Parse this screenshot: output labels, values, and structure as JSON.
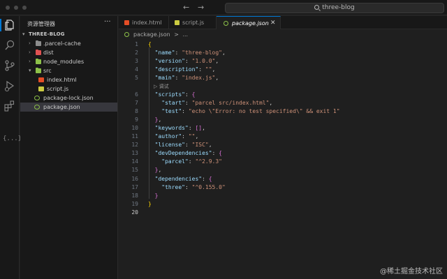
{
  "titlebar": {
    "search_text": "three-blog",
    "back_arrow": "←",
    "forward_arrow": "→"
  },
  "activity": {
    "extra_label": "{...}"
  },
  "sidebar": {
    "title": "资源管理器",
    "more": "···",
    "root": "THREE-BLOG",
    "items": [
      {
        "label": ".parcel-cache",
        "kind": "folder",
        "color": "#8c8c8c",
        "expanded": false
      },
      {
        "label": "dist",
        "kind": "folder",
        "color": "#e05252",
        "expanded": false
      },
      {
        "label": "node_modules",
        "kind": "folder",
        "color": "#8dc149",
        "expanded": false
      },
      {
        "label": "src",
        "kind": "folder",
        "color": "#8dc149",
        "expanded": true
      },
      {
        "label": "index.html",
        "kind": "file",
        "color": "#e44d26"
      },
      {
        "label": "script.js",
        "kind": "file",
        "color": "#cbcb41"
      },
      {
        "label": "package-lock.json",
        "kind": "file",
        "color": "#8dc149"
      },
      {
        "label": "package.json",
        "kind": "file",
        "color": "#8dc149",
        "selected": true
      }
    ]
  },
  "tabs": [
    {
      "label": "index.html",
      "color": "#e44d26"
    },
    {
      "label": "script.js",
      "color": "#cbcb41"
    },
    {
      "label": "package.json",
      "color": "#8dc149",
      "active": true,
      "close": "✕"
    }
  ],
  "breadcrumb": {
    "file": "package.json",
    "separator": ">",
    "rest": "..."
  },
  "codelens": "▷ 调试",
  "code_lines": [
    {
      "n": "1",
      "tokens": [
        [
          "br1",
          "{"
        ]
      ]
    },
    {
      "n": "2",
      "tokens": [
        [
          "p",
          "  "
        ],
        [
          "k",
          "\"name\""
        ],
        [
          "p",
          ": "
        ],
        [
          "s",
          "\"three-blog\""
        ],
        [
          "p",
          ","
        ]
      ]
    },
    {
      "n": "3",
      "tokens": [
        [
          "p",
          "  "
        ],
        [
          "k",
          "\"version\""
        ],
        [
          "p",
          ": "
        ],
        [
          "s",
          "\"1.0.0\""
        ],
        [
          "p",
          ","
        ]
      ]
    },
    {
      "n": "4",
      "tokens": [
        [
          "p",
          "  "
        ],
        [
          "k",
          "\"description\""
        ],
        [
          "p",
          ": "
        ],
        [
          "s",
          "\"\""
        ],
        [
          "p",
          ","
        ]
      ]
    },
    {
      "n": "5",
      "tokens": [
        [
          "p",
          "  "
        ],
        [
          "k",
          "\"main\""
        ],
        [
          "p",
          ": "
        ],
        [
          "s",
          "\"index.js\""
        ],
        [
          "p",
          ","
        ]
      ]
    },
    {
      "n": "6",
      "tokens": [
        [
          "p",
          "  "
        ],
        [
          "k",
          "\"scripts\""
        ],
        [
          "p",
          ": "
        ],
        [
          "br2",
          "{"
        ]
      ]
    },
    {
      "n": "7",
      "tokens": [
        [
          "p",
          "    "
        ],
        [
          "k",
          "\"start\""
        ],
        [
          "p",
          ": "
        ],
        [
          "s",
          "\"parcel src/index.html\""
        ],
        [
          "p",
          ","
        ]
      ]
    },
    {
      "n": "8",
      "tokens": [
        [
          "p",
          "    "
        ],
        [
          "k",
          "\"test\""
        ],
        [
          "p",
          ": "
        ],
        [
          "s",
          "\"echo \\\"Error: no test specified\\\" && exit 1\""
        ]
      ]
    },
    {
      "n": "9",
      "tokens": [
        [
          "p",
          "  "
        ],
        [
          "br2",
          "}"
        ],
        [
          "p",
          ","
        ]
      ]
    },
    {
      "n": "10",
      "tokens": [
        [
          "p",
          "  "
        ],
        [
          "k",
          "\"keywords\""
        ],
        [
          "p",
          ": "
        ],
        [
          "br2",
          "[]"
        ],
        [
          "p",
          ","
        ]
      ]
    },
    {
      "n": "11",
      "tokens": [
        [
          "p",
          "  "
        ],
        [
          "k",
          "\"author\""
        ],
        [
          "p",
          ": "
        ],
        [
          "s",
          "\"\""
        ],
        [
          "p",
          ","
        ]
      ]
    },
    {
      "n": "12",
      "tokens": [
        [
          "p",
          "  "
        ],
        [
          "k",
          "\"license\""
        ],
        [
          "p",
          ": "
        ],
        [
          "s",
          "\"ISC\""
        ],
        [
          "p",
          ","
        ]
      ]
    },
    {
      "n": "13",
      "tokens": [
        [
          "p",
          "  "
        ],
        [
          "k",
          "\"devDependencies\""
        ],
        [
          "p",
          ": "
        ],
        [
          "br2",
          "{"
        ]
      ]
    },
    {
      "n": "14",
      "tokens": [
        [
          "p",
          "    "
        ],
        [
          "k",
          "\"parcel\""
        ],
        [
          "p",
          ": "
        ],
        [
          "s",
          "\"^2.9.3\""
        ]
      ]
    },
    {
      "n": "15",
      "tokens": [
        [
          "p",
          "  "
        ],
        [
          "br2",
          "}"
        ],
        [
          "p",
          ","
        ]
      ]
    },
    {
      "n": "16",
      "tokens": [
        [
          "p",
          "  "
        ],
        [
          "k",
          "\"dependencies\""
        ],
        [
          "p",
          ": "
        ],
        [
          "br2",
          "{"
        ]
      ]
    },
    {
      "n": "17",
      "tokens": [
        [
          "p",
          "    "
        ],
        [
          "k",
          "\"three\""
        ],
        [
          "p",
          ": "
        ],
        [
          "s",
          "\"^0.155.0\""
        ]
      ]
    },
    {
      "n": "18",
      "tokens": [
        [
          "p",
          "  "
        ],
        [
          "br2",
          "}"
        ]
      ]
    },
    {
      "n": "19",
      "tokens": [
        [
          "br1",
          "}"
        ]
      ]
    },
    {
      "n": "20",
      "tokens": [],
      "current": true
    }
  ],
  "watermark": "@稀土掘金技术社区"
}
